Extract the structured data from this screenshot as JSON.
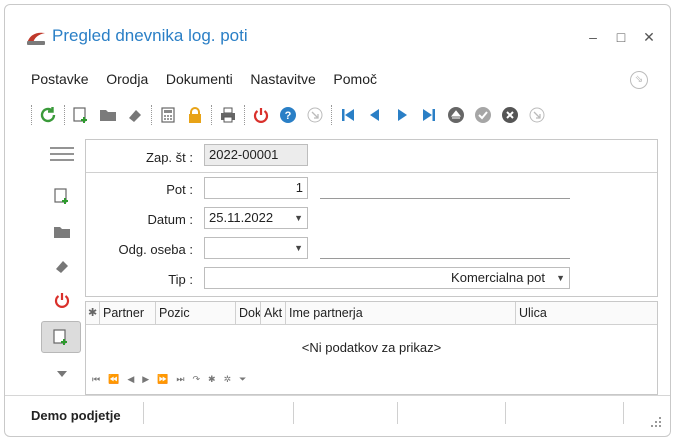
{
  "window": {
    "title": "Pregled dnevnika log. poti",
    "minimize": "–",
    "maximize": "□",
    "close": "✕"
  },
  "menu": {
    "items": [
      "Postavke",
      "Orodja",
      "Dokumenti",
      "Nastavitve",
      "Pomoč"
    ]
  },
  "form": {
    "zap_label": "Zap. št :",
    "zap_value": "2022-00001",
    "pot_label": "Pot :",
    "pot_value": "1",
    "datum_label": "Datum :",
    "datum_value": "25.11.2022",
    "oseba_label": "Odg. oseba :",
    "oseba_value": "",
    "tip_label": "Tip :",
    "tip_value": "Komercialna pot"
  },
  "grid": {
    "columns": [
      "Partner",
      "Pozic",
      "Dok",
      "Akt",
      "Ime partnerja",
      "Ulica"
    ],
    "empty_text": "<Ni podatkov za prikaz>"
  },
  "status": {
    "company": "Demo podjetje"
  },
  "colors": {
    "accent_blue": "#2a7fc6",
    "refresh_green": "#3a9a3a",
    "power_red": "#d9302b",
    "lock_yellow": "#e8a317"
  }
}
